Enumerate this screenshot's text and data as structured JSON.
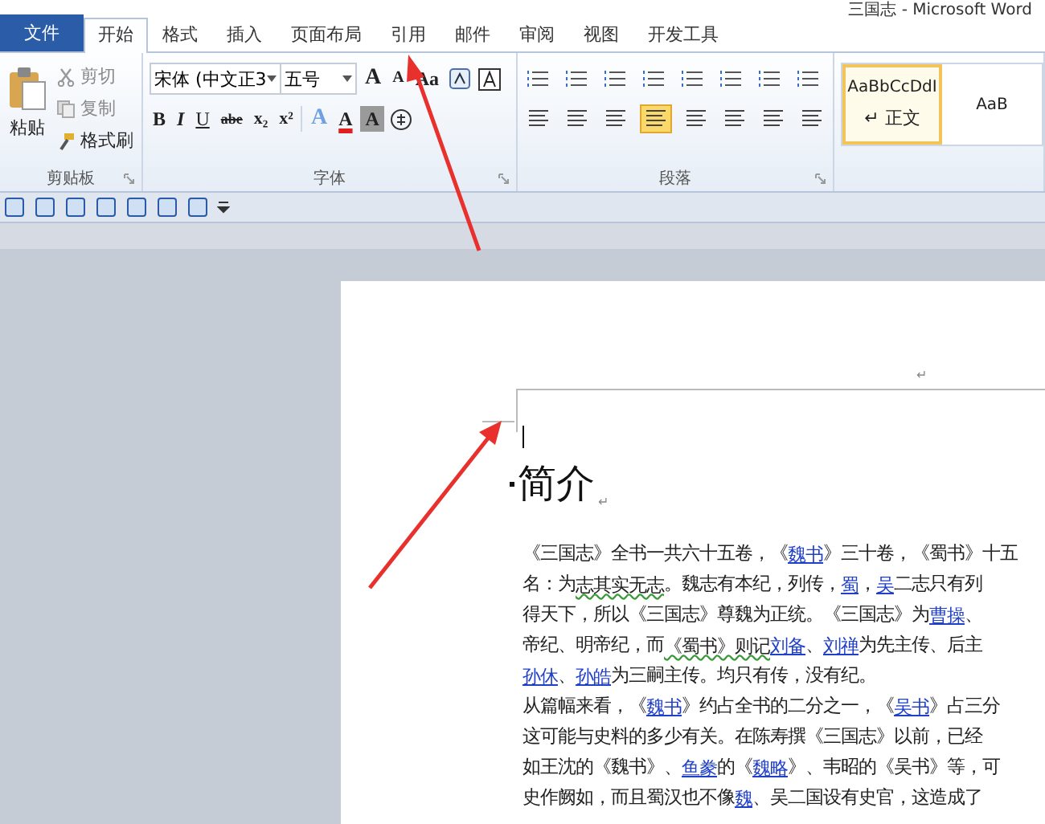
{
  "window": {
    "title": "三国志 - Microsoft Word"
  },
  "tabs": [
    {
      "label": "文件",
      "kind": "file",
      "selected": false
    },
    {
      "label": "开始",
      "kind": "tab",
      "selected": true
    },
    {
      "label": "格式",
      "kind": "tab",
      "selected": false
    },
    {
      "label": "插入",
      "kind": "tab",
      "selected": false
    },
    {
      "label": "页面布局",
      "kind": "tab",
      "selected": false
    },
    {
      "label": "引用",
      "kind": "tab",
      "selected": false
    },
    {
      "label": "邮件",
      "kind": "tab",
      "selected": false
    },
    {
      "label": "审阅",
      "kind": "tab",
      "selected": false
    },
    {
      "label": "视图",
      "kind": "tab",
      "selected": false
    },
    {
      "label": "开发工具",
      "kind": "tab",
      "selected": false
    }
  ],
  "clipboard": {
    "paste": "粘贴",
    "cut": "剪切",
    "copy": "复制",
    "format_painter": "格式刷",
    "label": "剪贴板"
  },
  "font": {
    "face": "宋体 (中文正3",
    "size": "五号",
    "label": "字体",
    "row1": [
      {
        "glyph": "A",
        "kind": "grow"
      },
      {
        "glyph": "A",
        "kind": "shrink"
      },
      {
        "glyph": "Aa",
        "kind": "case"
      }
    ],
    "row2": [
      {
        "glyph": "B",
        "kind": "bold"
      },
      {
        "glyph": "I",
        "kind": "italic"
      },
      {
        "glyph": "U",
        "kind": "underline"
      },
      {
        "glyph": "abe",
        "kind": "strike"
      },
      {
        "glyph": "x₂",
        "kind": "sub"
      },
      {
        "glyph": "x²",
        "kind": "sup"
      }
    ],
    "row2b": [
      {
        "glyph": "A",
        "kind": "effects"
      },
      {
        "glyph": "A",
        "kind": "color"
      },
      {
        "glyph": "A",
        "kind": "shade"
      }
    ]
  },
  "paragraph": {
    "label": "段落"
  },
  "styles": [
    {
      "sample": "AaBbCcDdI",
      "name": "正文",
      "selected": true
    },
    {
      "sample": "AaB",
      "selected": false
    }
  ],
  "document": {
    "heading": "简介",
    "para_mark": "↵",
    "lines": [
      [
        {
          "kind": "plain",
          "text": "《三国志》全书一共六十五卷，《"
        },
        {
          "kind": "link",
          "text": "魏书"
        },
        {
          "kind": "plain",
          "text": "》三十卷，《蜀书》十五"
        }
      ],
      [
        {
          "kind": "plain",
          "text": "名：为"
        },
        {
          "kind": "grammar",
          "text": "志其实无志"
        },
        {
          "kind": "plain",
          "text": "。魏志有本纪，列传，"
        },
        {
          "kind": "link",
          "text": "蜀"
        },
        {
          "kind": "plain",
          "text": "，"
        },
        {
          "kind": "link",
          "text": "吴"
        },
        {
          "kind": "plain",
          "text": "二志只有列"
        }
      ],
      [
        {
          "kind": "plain",
          "text": "得天下，所以《三国志》尊魏为正统。《三国志》为"
        },
        {
          "kind": "link",
          "text": "曹操"
        },
        {
          "kind": "plain",
          "text": "、"
        }
      ],
      [
        {
          "kind": "plain",
          "text": "帝纪、明帝纪，而"
        },
        {
          "kind": "grammar",
          "text": "《蜀书》则记"
        },
        {
          "kind": "link",
          "text": "刘备"
        },
        {
          "kind": "plain",
          "text": "、"
        },
        {
          "kind": "link",
          "text": "刘禅"
        },
        {
          "kind": "plain",
          "text": "为先主传、后主"
        }
      ],
      [
        {
          "kind": "link",
          "text": "孙休"
        },
        {
          "kind": "plain",
          "text": "、"
        },
        {
          "kind": "link",
          "text": "孙皓"
        },
        {
          "kind": "plain",
          "text": "为三嗣主传。均只有传，没有纪。"
        }
      ],
      [
        {
          "kind": "plain",
          "text": "从篇幅来看，《"
        },
        {
          "kind": "link",
          "text": "魏书"
        },
        {
          "kind": "plain",
          "text": "》约占全书的二分之一，《"
        },
        {
          "kind": "link",
          "text": "吴书"
        },
        {
          "kind": "plain",
          "text": "》占三分"
        }
      ],
      [
        {
          "kind": "plain",
          "text": "这可能与史料的多少有关。在陈寿撰《三国志》以前，已经"
        }
      ],
      [
        {
          "kind": "plain",
          "text": "如王沈的《魏书》、"
        },
        {
          "kind": "link",
          "text": "鱼豢"
        },
        {
          "kind": "plain",
          "text": "的《"
        },
        {
          "kind": "link",
          "text": "魏略"
        },
        {
          "kind": "plain",
          "text": "》、韦昭的《吴书》等，可"
        }
      ],
      [
        {
          "kind": "plain",
          "text": "史作阙如，而且蜀汉也不像"
        },
        {
          "kind": "link",
          "text": "魏"
        },
        {
          "kind": "plain",
          "text": "、吴二国设有史官，这造成了"
        }
      ]
    ]
  }
}
